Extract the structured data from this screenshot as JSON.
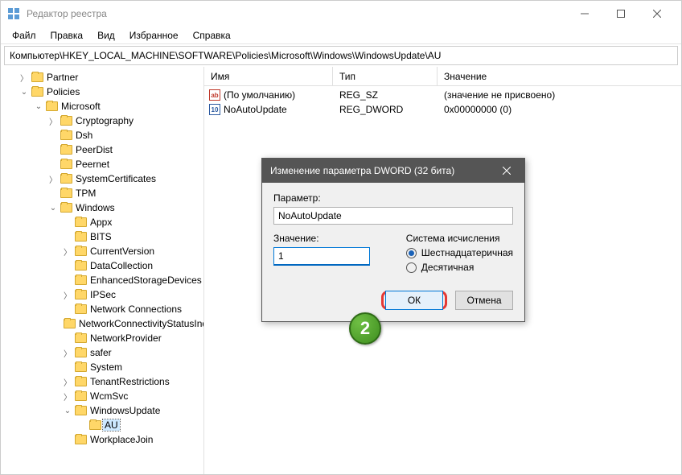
{
  "title": "Редактор реестра",
  "menu": [
    "Файл",
    "Правка",
    "Вид",
    "Избранное",
    "Справка"
  ],
  "address": "Компьютер\\HKEY_LOCAL_MACHINE\\SOFTWARE\\Policies\\Microsoft\\Windows\\WindowsUpdate\\AU",
  "columns": {
    "name": "Имя",
    "type": "Тип",
    "data": "Значение"
  },
  "rows": [
    {
      "icon": "str",
      "name": "(По умолчанию)",
      "type": "REG_SZ",
      "data": "(значение не присвоено)"
    },
    {
      "icon": "bin",
      "name": "NoAutoUpdate",
      "type": "REG_DWORD",
      "data": "0x00000000 (0)"
    }
  ],
  "tree": {
    "partner": "Partner",
    "policies": "Policies",
    "microsoft": "Microsoft",
    "cryptography": "Cryptography",
    "dsh": "Dsh",
    "peerdist": "PeerDist",
    "peernet": "Peernet",
    "systemcert": "SystemCertificates",
    "tpm": "TPM",
    "windows": "Windows",
    "appx": "Appx",
    "bits": "BITS",
    "currentversion": "CurrentVersion",
    "datacollection": "DataCollection",
    "enhancedstorage": "EnhancedStorageDevices",
    "ipsec": "IPSec",
    "netconn1": "Network Connections",
    "netconn2": "NetworkConnectivityStatusIndicator",
    "netprov": "NetworkProvider",
    "safer": "safer",
    "system": "System",
    "tenant": "TenantRestrictions",
    "wcmsvc": "WcmSvc",
    "winupdate": "WindowsUpdate",
    "au": "AU",
    "workplace": "WorkplaceJoin"
  },
  "dialog": {
    "title": "Изменение параметра DWORD (32 бита)",
    "param_label": "Параметр:",
    "param_value": "NoAutoUpdate",
    "value_label": "Значение:",
    "value": "1",
    "base_label": "Система исчисления",
    "hex": "Шестнадцатеричная",
    "dec": "Десятичная",
    "ok": "ОК",
    "cancel": "Отмена"
  },
  "callout": "2"
}
